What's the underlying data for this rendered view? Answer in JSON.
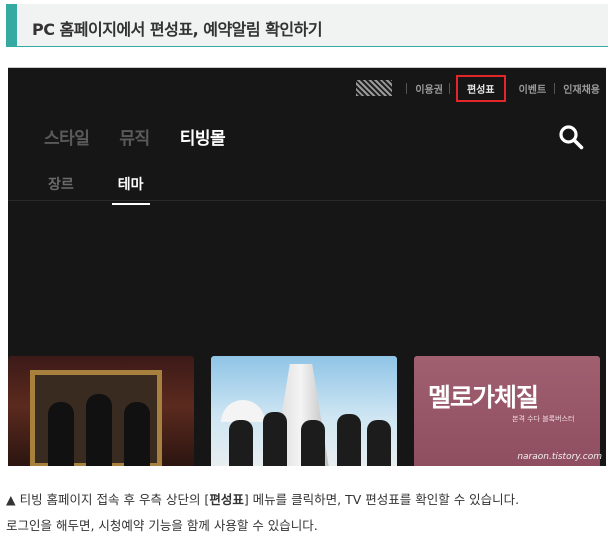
{
  "heading": {
    "title": "PC 홈페이지에서 편성표, 예약알림 확인하기"
  },
  "topnav": {
    "items": [
      "이용권",
      "편성표",
      "이벤트",
      "인재채용"
    ]
  },
  "mainnav": {
    "items": [
      "스타일",
      "뮤직",
      "티빙몰"
    ]
  },
  "subnav": {
    "items": [
      "장르",
      "테마"
    ]
  },
  "posters": [
    {
      "title": "",
      "subtitle": ""
    },
    {
      "title": "",
      "subtitle": ""
    },
    {
      "title": "멜로가체질",
      "subtitle": "본격 수다 블록버스터"
    }
  ],
  "watermark": "naraon.tistory.com",
  "caption": {
    "line1_prefix": "▲ 티빙 홈페이지 접속 후 우측 상단의 [",
    "line1_bold": "편성표",
    "line1_suffix": "] 메뉴를 클릭하면, TV 편성표를 확인할 수 있습니다.",
    "line2": "로그인을 해두면, 시청예약 기능을 함께 사용할 수 있습니다."
  },
  "colors": {
    "accent": "#36a9a2",
    "highlight": "#e3262a",
    "background": "#161616"
  }
}
